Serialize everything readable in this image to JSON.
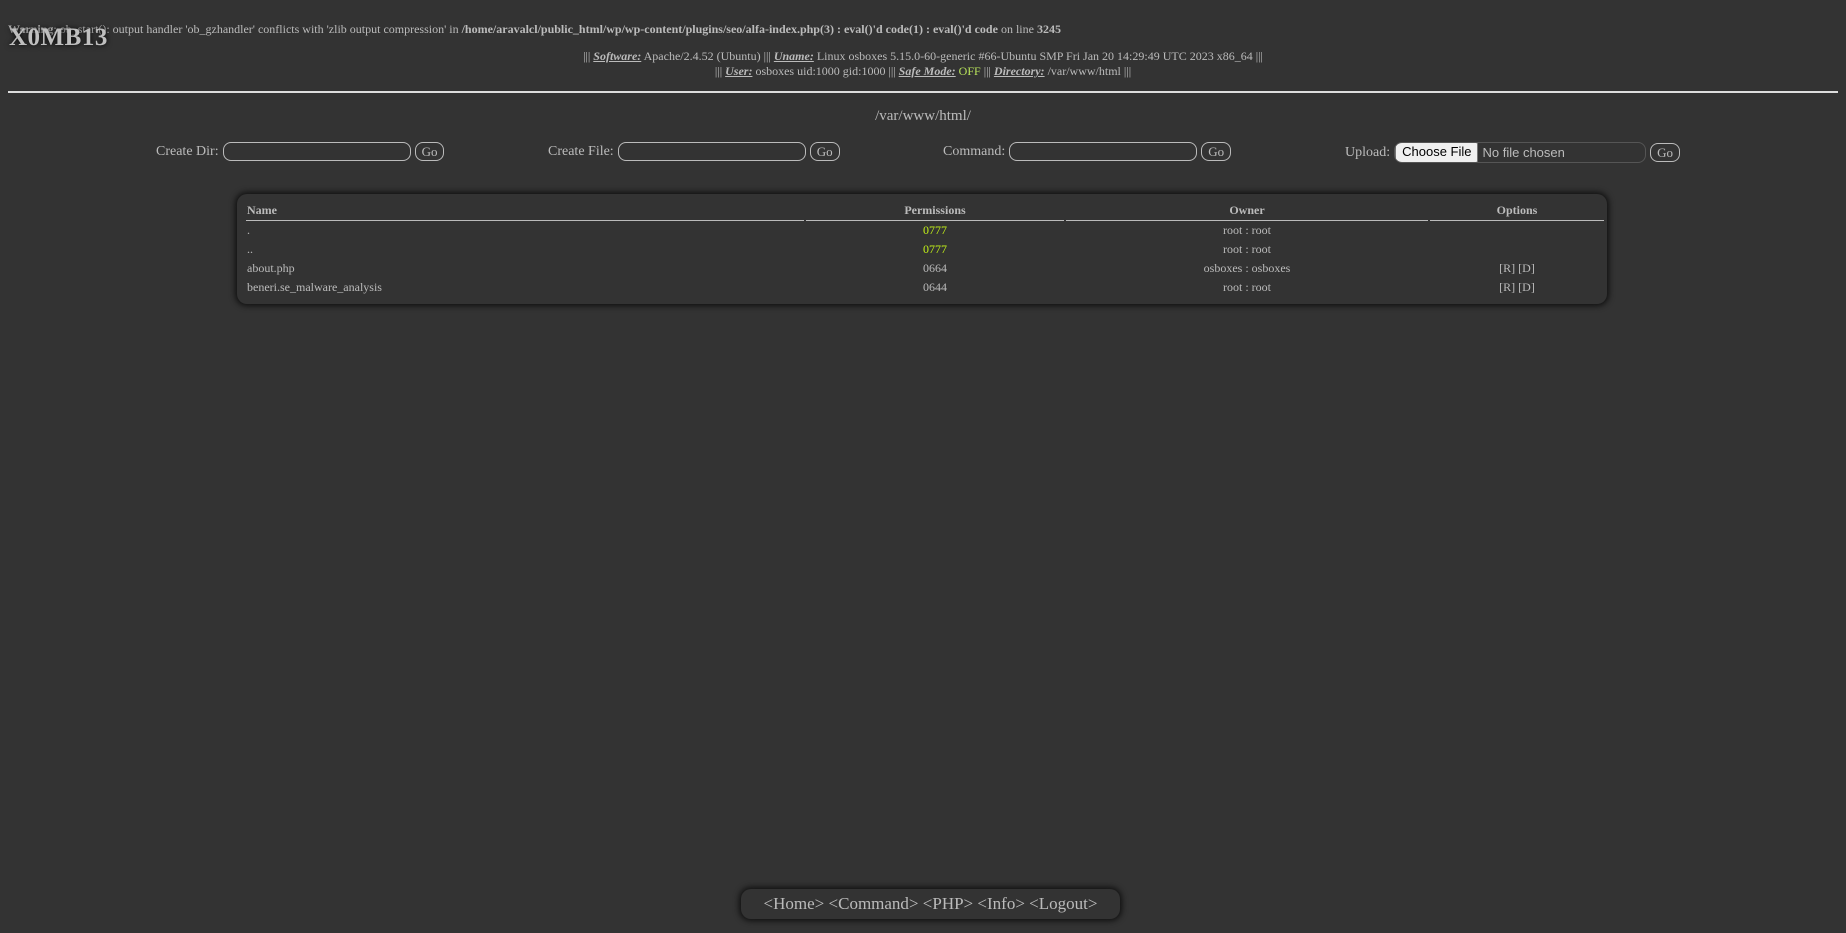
{
  "warning": {
    "prefix": "Warning",
    "message": ": ob_start(): output handler 'ob_gzhandler' conflicts with 'zlib output compression' in ",
    "file": "/home/aravalcl/public_html/wp/wp-content/plugins/seo/alfa-index.php(3) : eval()'d code(1) : eval()'d code",
    "line_text": " on line ",
    "line_number": "3245"
  },
  "brand": "X0MB13",
  "sysinfo": {
    "sep": "|||",
    "software_label": "Software:",
    "software_value": "Apache/2.4.52 (Ubuntu)",
    "uname_label": "Uname:",
    "uname_value": "Linux osboxes 5.15.0-60-generic #66-Ubuntu SMP Fri Jan 20 14:29:49 UTC 2023 x86_64",
    "user_label": "User:",
    "user_value": "osboxes uid:1000 gid:1000",
    "safemode_label": "Safe Mode:",
    "safemode_value": "OFF",
    "directory_label": "Directory:",
    "directory_value": "/var/www/html"
  },
  "current_path": "/var/www/html/",
  "forms": {
    "create_dir_label": "Create Dir:",
    "create_file_label": "Create File:",
    "command_label": "Command:",
    "upload_label": "Upload:",
    "go_label": "Go",
    "choose_file_label": "Choose File",
    "no_file_label": "No file chosen"
  },
  "colors": {
    "background": "#333333",
    "text": "#bbbbbb",
    "highlight": "#c3f218"
  },
  "table": {
    "headers": {
      "name": "Name",
      "permissions": "Permissions",
      "owner": "Owner",
      "options": "Options"
    },
    "rows": [
      {
        "name": ".",
        "permissions": "0777",
        "owner": "root : root",
        "options": ""
      },
      {
        "name": "..",
        "permissions": "0777",
        "owner": "root : root",
        "options": ""
      },
      {
        "name": "about.php",
        "permissions": "0664",
        "owner": "osboxes : osboxes",
        "options": "[R] [D]"
      },
      {
        "name": "beneri.se_malware_analysis",
        "permissions": "0644",
        "owner": "root : root",
        "options": "[R] [D]"
      }
    ]
  },
  "nav": {
    "home": "<Home>",
    "command": "<Command>",
    "php": "<PHP>",
    "info": "<Info>",
    "logout": "<Logout>"
  }
}
